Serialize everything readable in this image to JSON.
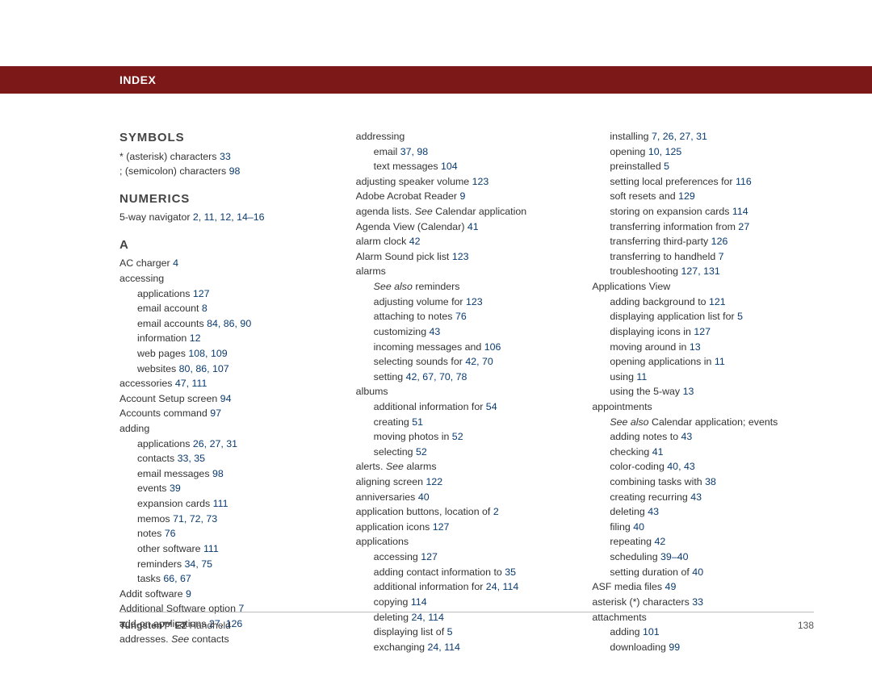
{
  "header": {
    "title": "INDEX"
  },
  "col1": {
    "sections": [
      {
        "head": "SYMBOLS",
        "entries": [
          {
            "text": "* (asterisk) characters",
            "pages": " 33"
          },
          {
            "text": "; (semicolon) characters",
            "pages": " 98"
          }
        ]
      },
      {
        "head": "NUMERICS",
        "entries": [
          {
            "text": "5-way navigator",
            "pages": " 2, 11, 12, 14–16"
          }
        ]
      },
      {
        "head": "A",
        "entries": [
          {
            "text": "AC charger",
            "pages": " 4"
          },
          {
            "text": "accessing"
          },
          {
            "text": "applications",
            "pages": " 127",
            "ind": 1
          },
          {
            "text": "email account",
            "pages": " 8",
            "ind": 1
          },
          {
            "text": "email accounts",
            "pages": " 84, 86, 90",
            "ind": 1
          },
          {
            "text": "information",
            "pages": " 12",
            "ind": 1
          },
          {
            "text": "web pages",
            "pages": " 108, 109",
            "ind": 1
          },
          {
            "text": "websites",
            "pages": " 80, 86, 107",
            "ind": 1
          },
          {
            "text": "accessories",
            "pages": " 47, 111"
          },
          {
            "text": "Account Setup screen",
            "pages": " 94"
          },
          {
            "text": "Accounts command",
            "pages": " 97"
          },
          {
            "text": "adding"
          },
          {
            "text": "applications",
            "pages": " 26, 27, 31",
            "ind": 1
          },
          {
            "text": "contacts",
            "pages": " 33, 35",
            "ind": 1
          },
          {
            "text": "email messages",
            "pages": " 98",
            "ind": 1
          },
          {
            "text": "events",
            "pages": " 39",
            "ind": 1
          },
          {
            "text": "expansion cards",
            "pages": " 111",
            "ind": 1
          },
          {
            "text": "memos",
            "pages": " 71, 72, 73",
            "ind": 1
          },
          {
            "text": "notes",
            "pages": " 76",
            "ind": 1
          },
          {
            "text": "other software",
            "pages": " 111",
            "ind": 1
          },
          {
            "text": "reminders",
            "pages": " 34, 75",
            "ind": 1
          },
          {
            "text": "tasks",
            "pages": " 66, 67",
            "ind": 1
          },
          {
            "text": "Addit software",
            "pages": " 9"
          },
          {
            "text": "Additional Software option",
            "pages": " 7"
          },
          {
            "text": "add-on applications",
            "pages": " 27, 126"
          },
          {
            "text": "addresses. ",
            "see": "See",
            "after": " contacts"
          }
        ]
      }
    ]
  },
  "col2": {
    "entries": [
      {
        "text": "addressing"
      },
      {
        "text": "email",
        "pages": " 37, 98",
        "ind": 1
      },
      {
        "text": "text messages",
        "pages": " 104",
        "ind": 1
      },
      {
        "text": "adjusting speaker volume",
        "pages": " 123"
      },
      {
        "text": "Adobe Acrobat Reader",
        "pages": " 9"
      },
      {
        "text": "agenda lists. ",
        "see": "See",
        "after": " Calendar application"
      },
      {
        "text": "Agenda View (Calendar)",
        "pages": " 41"
      },
      {
        "text": "alarm clock",
        "pages": " 42"
      },
      {
        "text": "Alarm Sound pick list",
        "pages": " 123"
      },
      {
        "text": "alarms"
      },
      {
        "see": "See also",
        "after": " reminders",
        "ind": 1
      },
      {
        "text": "adjusting volume for",
        "pages": " 123",
        "ind": 1
      },
      {
        "text": "attaching to notes",
        "pages": " 76",
        "ind": 1
      },
      {
        "text": "customizing",
        "pages": " 43",
        "ind": 1
      },
      {
        "text": "incoming messages and",
        "pages": " 106",
        "ind": 1
      },
      {
        "text": "selecting sounds for",
        "pages": " 42, 70",
        "ind": 1
      },
      {
        "text": "setting",
        "pages": " 42, 67, 70, 78",
        "ind": 1
      },
      {
        "text": "albums"
      },
      {
        "text": "additional information for",
        "pages": " 54",
        "ind": 1
      },
      {
        "text": "creating",
        "pages": " 51",
        "ind": 1
      },
      {
        "text": "moving photos in",
        "pages": " 52",
        "ind": 1
      },
      {
        "text": "selecting",
        "pages": " 52",
        "ind": 1
      },
      {
        "text": "alerts. ",
        "see": "See",
        "after": " alarms"
      },
      {
        "text": "aligning screen",
        "pages": " 122"
      },
      {
        "text": "anniversaries",
        "pages": " 40"
      },
      {
        "text": "application buttons, location of",
        "pages": " 2"
      },
      {
        "text": "application icons",
        "pages": " 127"
      },
      {
        "text": "applications"
      },
      {
        "text": "accessing",
        "pages": " 127",
        "ind": 1
      },
      {
        "text": "adding contact information to",
        "pages": " 35",
        "ind": 1
      },
      {
        "text": "additional information for",
        "pages": " 24, 114",
        "ind": 1
      },
      {
        "text": "copying",
        "pages": " 114",
        "ind": 1
      },
      {
        "text": "deleting",
        "pages": " 24, 114",
        "ind": 1
      },
      {
        "text": "displaying list of",
        "pages": " 5",
        "ind": 1
      },
      {
        "text": "exchanging",
        "pages": " 24, 114",
        "ind": 1
      }
    ]
  },
  "col3": {
    "entries": [
      {
        "text": "installing",
        "pages": " 7, 26, 27, 31",
        "ind": 1
      },
      {
        "text": "opening",
        "pages": " 10, 125",
        "ind": 1
      },
      {
        "text": "preinstalled",
        "pages": " 5",
        "ind": 1
      },
      {
        "text": "setting local preferences for",
        "pages": " 116",
        "ind": 1
      },
      {
        "text": "soft resets and",
        "pages": " 129",
        "ind": 1
      },
      {
        "text": "storing on expansion cards",
        "pages": " 114",
        "ind": 1
      },
      {
        "text": "transferring information from",
        "pages": " 27",
        "ind": 1
      },
      {
        "text": "transferring third-party",
        "pages": " 126",
        "ind": 1
      },
      {
        "text": "transferring to handheld",
        "pages": " 7",
        "ind": 1
      },
      {
        "text": "troubleshooting",
        "pages": " 127, 131",
        "ind": 1
      },
      {
        "text": "Applications View"
      },
      {
        "text": "adding background to",
        "pages": " 121",
        "ind": 1
      },
      {
        "text": "displaying application list for",
        "pages": " 5",
        "ind": 1
      },
      {
        "text": "displaying icons in",
        "pages": " 127",
        "ind": 1
      },
      {
        "text": "moving around in",
        "pages": " 13",
        "ind": 1
      },
      {
        "text": "opening applications in",
        "pages": " 11",
        "ind": 1
      },
      {
        "text": "using",
        "pages": " 11",
        "ind": 1
      },
      {
        "text": "using the 5-way",
        "pages": " 13",
        "ind": 1
      },
      {
        "text": "appointments"
      },
      {
        "see": "See also",
        "after": " Calendar application; events",
        "ind": 1
      },
      {
        "text": "adding notes to",
        "pages": " 43",
        "ind": 1
      },
      {
        "text": "checking",
        "pages": " 41",
        "ind": 1
      },
      {
        "text": "color-coding",
        "pages": " 40, 43",
        "ind": 1
      },
      {
        "text": "combining tasks with",
        "pages": " 38",
        "ind": 1
      },
      {
        "text": "creating recurring",
        "pages": " 43",
        "ind": 1
      },
      {
        "text": "deleting",
        "pages": " 43",
        "ind": 1
      },
      {
        "text": "filing",
        "pages": " 40",
        "ind": 1
      },
      {
        "text": "repeating",
        "pages": " 42",
        "ind": 1
      },
      {
        "text": "scheduling",
        "pages": " 39–40",
        "ind": 1
      },
      {
        "text": "setting duration of",
        "pages": " 40",
        "ind": 1
      },
      {
        "text": "ASF media files",
        "pages": " 49"
      },
      {
        "text": "asterisk (*) characters",
        "pages": " 33"
      },
      {
        "text": "attachments"
      },
      {
        "text": "adding",
        "pages": " 101",
        "ind": 1
      },
      {
        "text": "downloading",
        "pages": " 99",
        "ind": 1
      }
    ]
  },
  "footer": {
    "product_bold": "Tungsten™ E2",
    "product_rest": " Handheld",
    "page": "138"
  }
}
